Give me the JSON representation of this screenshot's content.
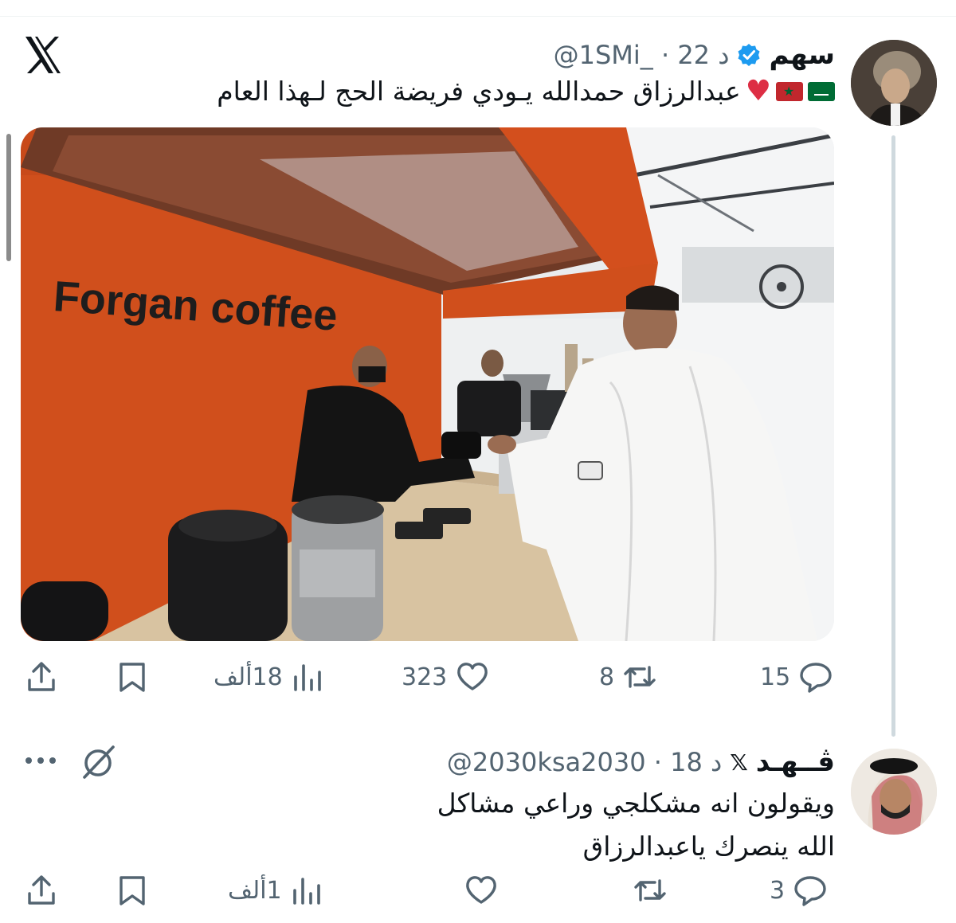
{
  "tweet1": {
    "display_name": "سهم",
    "handle": "@1SMi_",
    "time": "22 د",
    "text": "عبدالرزاق حمدالله يـودي فريضة الحج لـهذا العام",
    "emoji": [
      "heart-emoji",
      "morocco-flag-emoji",
      "saudi-flag-emoji"
    ],
    "media": {
      "sign_text": "Forgan coffee"
    },
    "actions": {
      "replies": "15",
      "reposts": "8",
      "likes": "323",
      "views": "18ألف"
    }
  },
  "tweet2": {
    "display_name": "ڤــهـد",
    "handle": "@2030ksa2030",
    "time": "18 د",
    "text_line1": "ويقولون انه مشكلجي وراعي مشاكل",
    "text_line2": "الله ينصرك ياعبدالرزاق",
    "actions": {
      "replies": "3",
      "reposts": "",
      "likes": "",
      "views": "1ألف"
    }
  },
  "colors": {
    "verified_badge": "#1d9bf0",
    "secondary_text": "#536471",
    "primary_text": "#0f1419",
    "cafe_orange": "#d04f1c"
  }
}
